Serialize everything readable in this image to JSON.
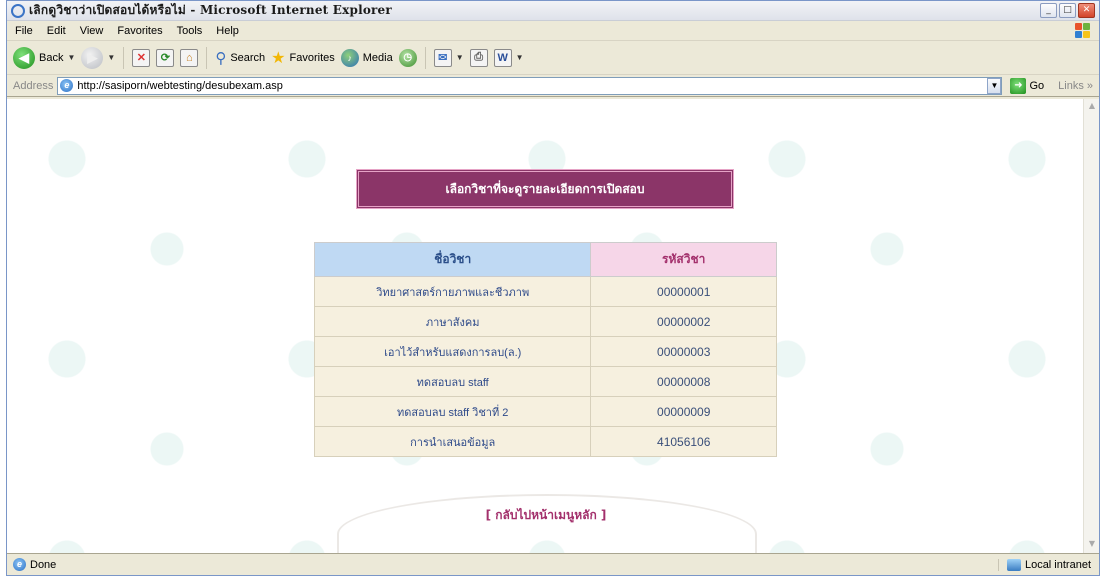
{
  "window": {
    "title": "เลิกดูวิชาว่าเปิดสอบได้หรือไม่ - Microsoft Internet Explorer",
    "controls": [
      "_",
      "□",
      "✕"
    ]
  },
  "menubar": {
    "items": [
      "File",
      "Edit",
      "View",
      "Favorites",
      "Tools",
      "Help"
    ]
  },
  "toolbar": {
    "back_label": "Back",
    "search_label": "Search",
    "favorites_label": "Favorites",
    "media_label": "Media"
  },
  "addressbar": {
    "label": "Address",
    "url": "http://sasiporn/webtesting/desubexam.asp",
    "go_label": "Go",
    "links_label": "Links »"
  },
  "page": {
    "banner": "เลือกวิชาที่จะดูรายละเอียดการเปิดสอบ",
    "table": {
      "headers": [
        "ชื่อวิชา",
        "รหัสวิชา"
      ],
      "rows": [
        [
          "วิทยาศาสตร์กายภาพและชีวภาพ",
          "00000001"
        ],
        [
          "ภาษาสังคม",
          "00000002"
        ],
        [
          "เอาไว้สำหรับแสดงการลบ(ล.)",
          "00000003"
        ],
        [
          "ทดสอบลบ staff",
          "00000008"
        ],
        [
          "ทดสอบลบ staff วิชาที่ 2",
          "00000009"
        ],
        [
          "การนำเสนอข้อมูล",
          "41056106"
        ]
      ]
    },
    "back_link": "[ กลับไปหน้าเมนูหลัก ]"
  },
  "statusbar": {
    "status": "Done",
    "zone": "Local intranet"
  },
  "colors": {
    "banner_bg": "#8b3568",
    "header_name_bg": "#bfd9f3",
    "header_code_bg": "#f6d6e8",
    "row_bg": "#f6f0df",
    "link": "#a3306c"
  }
}
